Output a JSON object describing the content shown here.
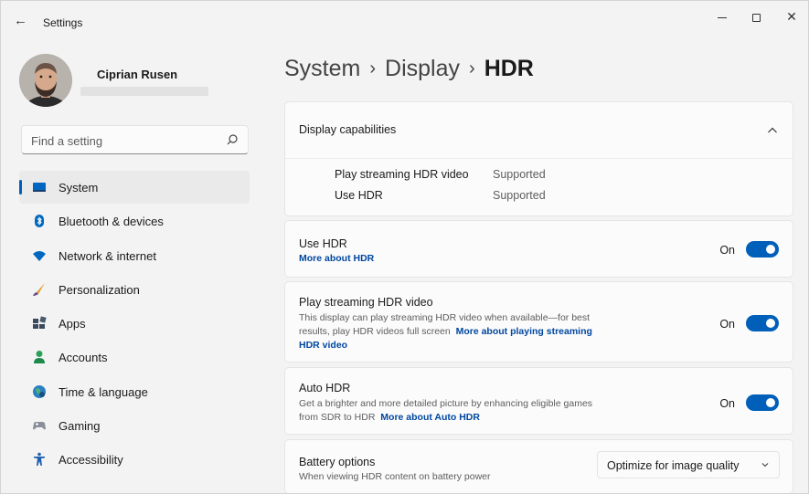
{
  "window": {
    "title": "Settings",
    "back_glyph": "←",
    "close_glyph": "✕"
  },
  "profile": {
    "name": "Ciprian Rusen"
  },
  "search": {
    "placeholder": "Find a setting"
  },
  "sidebar": {
    "items": [
      {
        "label": "System",
        "icon": "system-display-icon",
        "active": true
      },
      {
        "label": "Bluetooth & devices",
        "icon": "bluetooth-icon"
      },
      {
        "label": "Network & internet",
        "icon": "wifi-icon"
      },
      {
        "label": "Personalization",
        "icon": "brush-icon"
      },
      {
        "label": "Apps",
        "icon": "apps-icon"
      },
      {
        "label": "Accounts",
        "icon": "person-icon"
      },
      {
        "label": "Time & language",
        "icon": "globe-clock-icon"
      },
      {
        "label": "Gaming",
        "icon": "gamepad-icon"
      },
      {
        "label": "Accessibility",
        "icon": "accessibility-icon"
      }
    ]
  },
  "breadcrumb": {
    "level1": "System",
    "level2": "Display",
    "current": "HDR",
    "separator": "›"
  },
  "capabilities": {
    "title": "Display capabilities",
    "rows": [
      {
        "label": "Play streaming HDR video",
        "value": "Supported"
      },
      {
        "label": "Use HDR",
        "value": "Supported"
      }
    ]
  },
  "use_hdr": {
    "title": "Use HDR",
    "link": "More about HDR",
    "state_label": "On",
    "on": true
  },
  "streaming": {
    "title": "Play streaming HDR video",
    "desc_line1": "This display can play streaming HDR video when available—for best",
    "desc_line2": "results, play HDR videos full screen",
    "link_part1": "More about playing streaming",
    "link_part2": "HDR video",
    "state_label": "On",
    "on": true
  },
  "auto_hdr": {
    "title": "Auto HDR",
    "desc_line1": "Get a brighter and more detailed picture by enhancing eligible games",
    "desc_line2": "from SDR to HDR",
    "link": "More about Auto HDR",
    "state_label": "On",
    "on": true
  },
  "battery": {
    "title": "Battery options",
    "desc": "When viewing HDR content on battery power",
    "selected": "Optimize for image quality"
  },
  "colors": {
    "accent": "#005fb8",
    "link": "#0047a0",
    "background": "#f3f3f3",
    "card": "#fbfbfb"
  }
}
